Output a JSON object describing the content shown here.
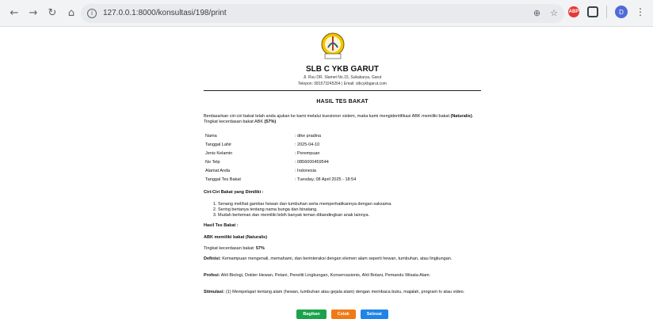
{
  "browser": {
    "url": "127.0.0.1:8000/konsultasi/198/print",
    "avatar_letter": "D"
  },
  "header": {
    "school_name": "SLB C YKB GARUT",
    "address": "Jl. Rsu DR. Slamet No.15, Sukakarya, Garut",
    "contact": "Telepon: 081573245264 | Email: slbcykbgarut.com"
  },
  "result": {
    "title": "HASIL TES BAKAT",
    "intro_a": "Berdasarkan ciri-ciri bakat telah anda ajukan ke kami melalui kuesioner sistem, maka kami mengidentifikasi ABK memiliki bakat ",
    "intro_b": "(Naturalis)",
    "intro_c": ". Tingkat kecerdasan bakat ABK ",
    "intro_d": "(57%)"
  },
  "profile": [
    {
      "label": "Nama",
      "value": ": dike pradina"
    },
    {
      "label": "Tanggal Lahir",
      "value": ": 2025-04-10"
    },
    {
      "label": "Jenis Kelamin",
      "value": ": Perempuan"
    },
    {
      "label": "No Telp",
      "value": ": 0856000459544"
    },
    {
      "label": "Alamat Anda",
      "value": ": Indonesia"
    },
    {
      "label": "Tanggal Tes Bakat",
      "value": ": Tuesday, 08 April 2025 - 18:54"
    }
  ],
  "traits": {
    "heading": "Ciri-Ciri Bakat yang Dimiliki :",
    "items": [
      "Senang melihat gambar hewan dan tumbuhan serta memperhatikannya dengan saksama.",
      "Sering bertanya tentang nama bunga dan binatang.",
      "Mudah berteman dan memiliki lebih banyak teman dibandingkan anak lainnya."
    ]
  },
  "summary": {
    "heading": "Hasil Tes Bakat :",
    "talent": "ABK memiliki bakat (Naturalis)",
    "level_label": "Tingkat kecerdasan bakat: ",
    "level_value": "57%",
    "definition_label": "Definisi:",
    "definition": " Kemampuan mengenali, memahami, dan berinteraksi dengan elemen alam seperti hewan, tumbuhan, atau lingkungan.",
    "profession_label": "Profesi:",
    "profession": " Ahli Biologi, Dokter Hewan, Petani, Peneliti Lingkungan, Konservasionis, Ahli Botani, Pemandu Wisata Alam.",
    "stimulation_label": "Stimulasi:",
    "stimulation": " (1) Mempelajari tentang alam (hewan, tumbuhan atau gejala alam) dengan membaca buku, majalah, program tv atau video."
  },
  "actions": {
    "share": "Bagikan",
    "print": "Cetak",
    "done": "Selesai"
  }
}
